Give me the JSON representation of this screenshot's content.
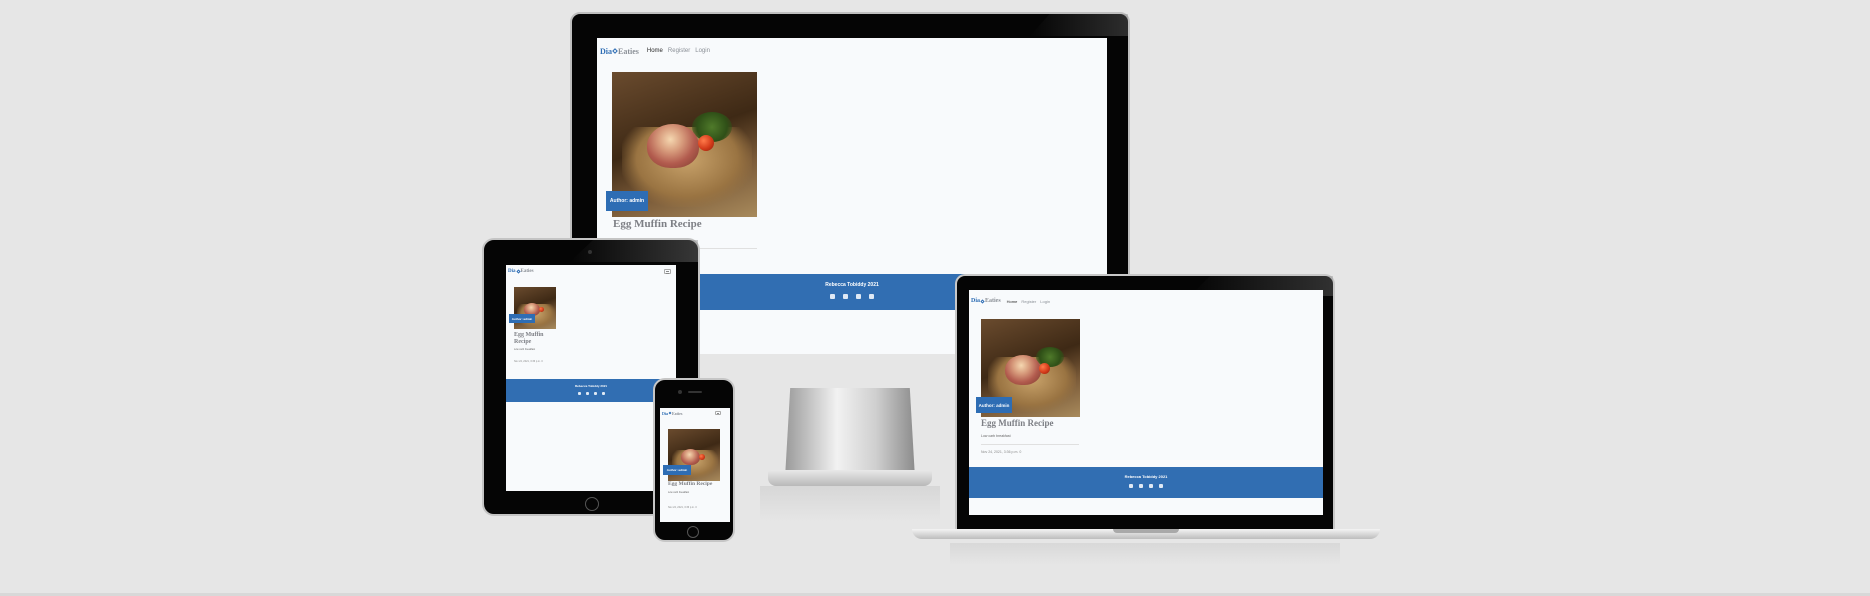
{
  "site": {
    "brand_left": "Dia",
    "brand_right": "Eaties",
    "nav": [
      {
        "label": "Home",
        "active": true
      },
      {
        "label": "Register",
        "active": false
      },
      {
        "label": "Login",
        "active": false
      }
    ]
  },
  "recipe": {
    "author_button": "Author: admin",
    "title": "Egg Muffin Recipe",
    "tablet_title_line1": "Egg Muffin",
    "tablet_title_line2": "Recipe",
    "subtitle": "Low carb breakfast",
    "meta": "Nov 24, 2021, 3:36 p.m. 0"
  },
  "footer": {
    "copyright": "Rebecca Tobiddy 2021",
    "social_icons": [
      "facebook-icon",
      "twitter-icon",
      "instagram-icon",
      "youtube-icon"
    ]
  },
  "colors": {
    "background": "#e6e6e6",
    "accent": "#316eb2",
    "screen": "#f8fafc"
  }
}
